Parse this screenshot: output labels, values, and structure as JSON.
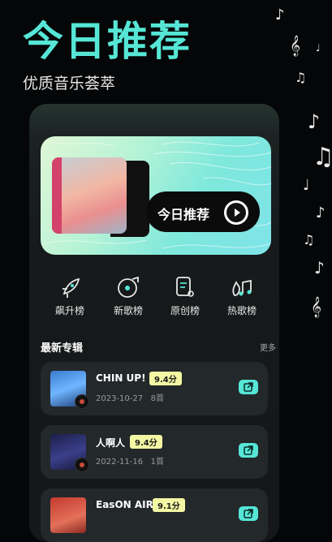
{
  "header": {
    "title": "今日推荐",
    "subtitle": "优质音乐荟萃"
  },
  "banner": {
    "label": "今日推荐",
    "play_icon": "play-icon"
  },
  "categories": [
    {
      "label": "飙升榜",
      "icon": "rocket-icon"
    },
    {
      "label": "新歌榜",
      "icon": "music-disc-icon"
    },
    {
      "label": "原创榜",
      "icon": "document-music-icon"
    },
    {
      "label": "热歌榜",
      "icon": "hot-music-icon"
    }
  ],
  "section": {
    "title": "最新专辑",
    "more": "更多"
  },
  "albums": [
    {
      "name": "CHIN UP!",
      "score": "9.4分",
      "date": "2023-10-27",
      "count": "8首"
    },
    {
      "name": "人啊人",
      "score": "9.4分",
      "date": "2022-11-16",
      "count": "1首"
    },
    {
      "name": "EasON AIR",
      "score": "9.1分",
      "date": "",
      "count": ""
    }
  ],
  "colors": {
    "accent": "#56e6d6",
    "score_bg": "#f3f6a3",
    "background": "#050607"
  }
}
